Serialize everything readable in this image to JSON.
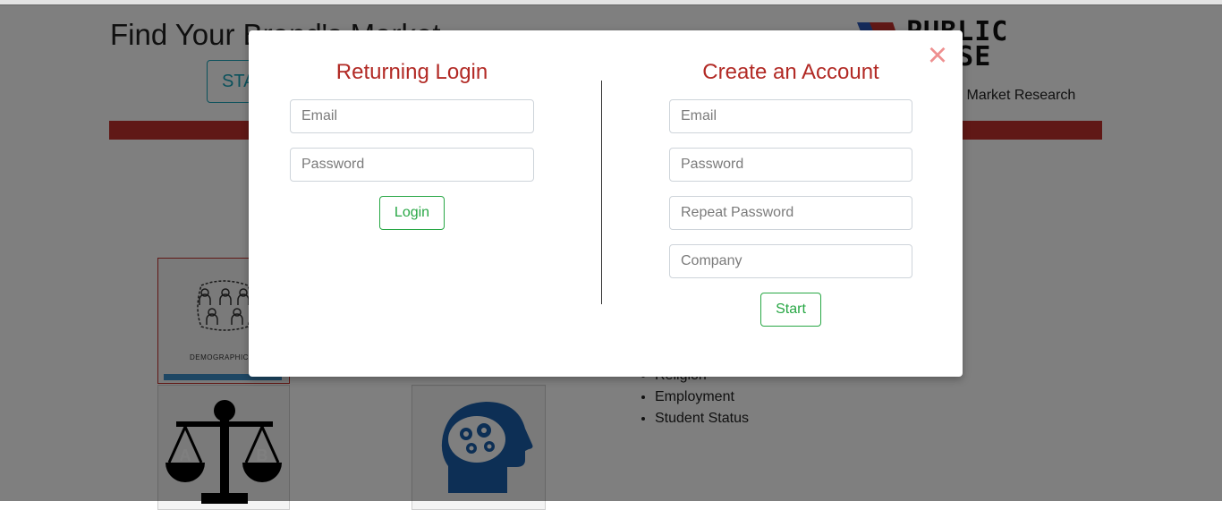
{
  "page": {
    "title": "Find Your Brand's Market",
    "start_button": "START",
    "logo": {
      "line1": "PUBLIC",
      "line2": "PULSE"
    },
    "tagline": "Content Market Research",
    "cards": [
      {
        "caption": "DEMOGRAPHICS",
        "icon": "people-network-icon"
      },
      {
        "icon": "scale-ab-icon"
      },
      {
        "icon": "brain-gears-head-icon"
      }
    ],
    "list_items": [
      "Religion",
      "Employment",
      "Student Status"
    ]
  },
  "modal": {
    "close_glyph": "×",
    "login": {
      "title": "Returning Login",
      "email_placeholder": "Email",
      "password_placeholder": "Password",
      "button": "Login"
    },
    "create": {
      "title": "Create an Account",
      "email_placeholder": "Email",
      "password_placeholder": "Password",
      "repeat_placeholder": "Repeat Password",
      "company_placeholder": "Company",
      "button": "Start"
    }
  },
  "colors": {
    "brand_red": "#b22a25",
    "success_green": "#28a745",
    "info_teal": "#17a2b8",
    "close_pink": "#ee8f8f"
  }
}
